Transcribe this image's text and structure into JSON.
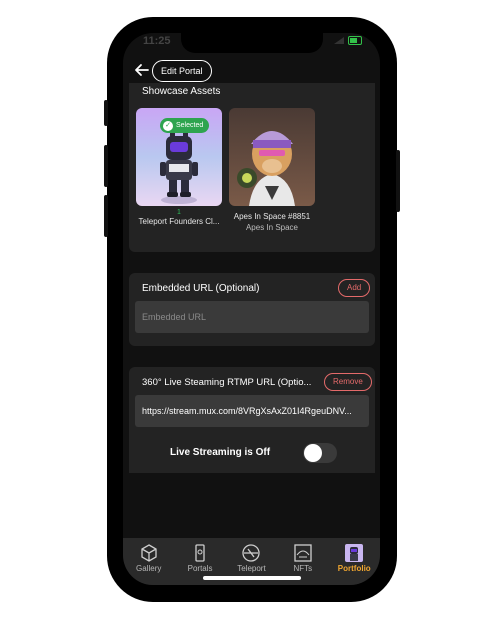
{
  "status": {
    "time": "11:25"
  },
  "header": {
    "edit_label": "Edit Portal"
  },
  "showcase": {
    "title": "Showcase Assets",
    "assets": [
      {
        "number": "1",
        "name": "Teleport Founders Cl...",
        "selected_label": "Selected"
      },
      {
        "name": "Apes In Space #8851",
        "collection": "Apes In Space"
      }
    ]
  },
  "embedded": {
    "title": "Embedded URL (Optional)",
    "add_label": "Add",
    "placeholder": "Embedded URL"
  },
  "livestream": {
    "title": "360° Live Steaming RTMP URL (Optio...",
    "remove_label": "Remove",
    "url_value": "https://stream.mux.com/8VRgXsAxZ01I4RgeuDNV...",
    "toggle_label": "Live Streaming is Off",
    "toggle_on": false
  },
  "tabs": [
    {
      "label": "Gallery",
      "icon": "gallery-cube-icon"
    },
    {
      "label": "Portals",
      "icon": "portals-icon"
    },
    {
      "label": "Teleport",
      "icon": "teleport-icon"
    },
    {
      "label": "NFTs",
      "icon": "nfts-icon"
    },
    {
      "label": "Portfolio",
      "icon": "portfolio-avatar-icon",
      "active": true
    }
  ],
  "colors": {
    "accent_active": "#f0a630",
    "danger": "#e46a6a",
    "selected_green": "#2ea44f"
  }
}
